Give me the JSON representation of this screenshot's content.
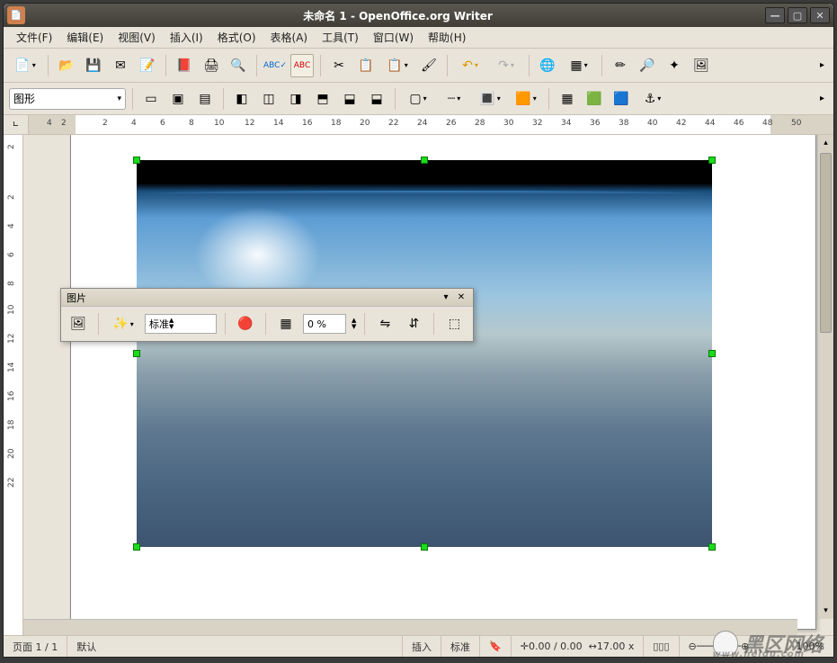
{
  "window": {
    "title": "未命名 1 - OpenOffice.org Writer"
  },
  "menu": {
    "file": "文件(F)",
    "edit": "编辑(E)",
    "view": "视图(V)",
    "insert": "插入(I)",
    "format": "格式(O)",
    "table": "表格(A)",
    "tools": "工具(T)",
    "window": "窗口(W)",
    "help": "帮助(H)"
  },
  "toolbar2": {
    "style_combo": "图形"
  },
  "ruler_h": {
    "left_shade": [
      "4",
      "2"
    ],
    "marks": [
      "2",
      "4",
      "6",
      "8",
      "10",
      "12",
      "14",
      "16",
      "18",
      "20",
      "22",
      "24",
      "26",
      "28",
      "30",
      "32",
      "34",
      "36",
      "38",
      "40",
      "42",
      "44",
      "46",
      "48",
      "50"
    ]
  },
  "ruler_v": {
    "marks": [
      "2",
      "2",
      "4",
      "6",
      "8",
      "10",
      "12",
      "14",
      "16",
      "18",
      "20",
      "22"
    ]
  },
  "float_panel": {
    "title": "图片",
    "filter_combo": "标准",
    "transparency": "0 %"
  },
  "status": {
    "page": "页面 1 / 1",
    "style": "默认",
    "insert": "插入",
    "std": "标准",
    "coords": "0.00 / 0.00",
    "size": "17.00 x",
    "zoom": "100%"
  },
  "watermark": {
    "text": "黑区网络",
    "url": "www.heidu.com"
  }
}
